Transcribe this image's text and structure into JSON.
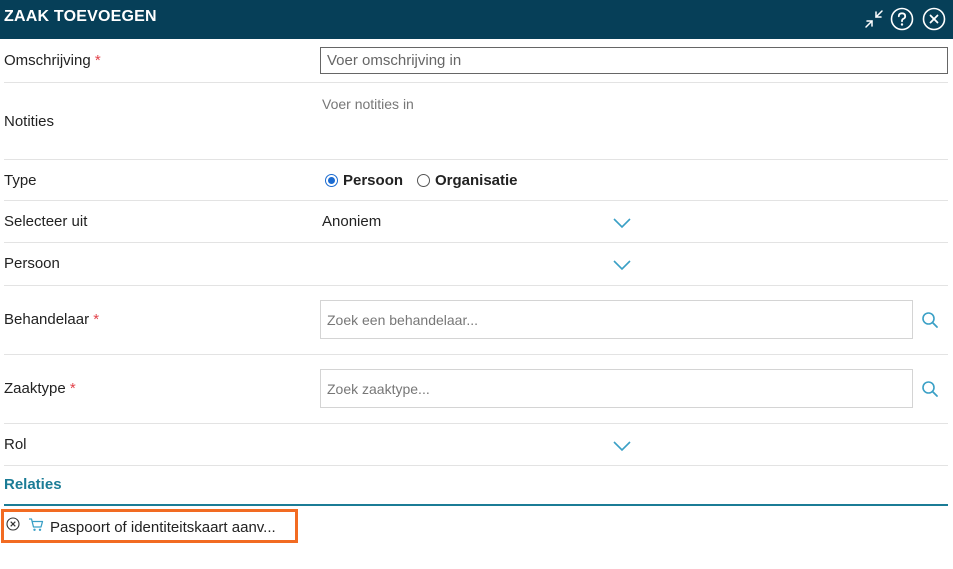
{
  "dialog": {
    "title": "ZAAK TOEVOEGEN",
    "icons": [
      "collapse-icon",
      "help-icon",
      "close-icon"
    ]
  },
  "form": {
    "omschrijving": {
      "label": "Omschrijving",
      "required_mark": "*",
      "placeholder": "Voer omschrijving in"
    },
    "notities": {
      "label": "Notities",
      "placeholder": "Voer notities in"
    },
    "type": {
      "label": "Type",
      "options": [
        {
          "label": "Persoon",
          "selected": true
        },
        {
          "label": "Organisatie",
          "selected": false
        }
      ]
    },
    "selecteer_uit": {
      "label": "Selecteer uit",
      "value": "Anoniem"
    },
    "persoon": {
      "label": "Persoon",
      "value": ""
    },
    "behandelaar": {
      "label": "Behandelaar",
      "required_mark": "*",
      "placeholder": "Zoek een behandelaar..."
    },
    "zaaktype": {
      "label": "Zaaktype",
      "required_mark": "*",
      "placeholder": "Zoek zaaktype..."
    },
    "rol": {
      "label": "Rol",
      "value": ""
    }
  },
  "relaties": {
    "title": "Relaties",
    "items": [
      {
        "text": "Paspoort of identiteitskaart aanv...",
        "icon": "cart-icon",
        "remove_icon": "remove-icon"
      }
    ]
  },
  "colors": {
    "header_bg": "#063f58",
    "accent": "#1b7c96",
    "required": "#e2434b",
    "highlight": "#f26b22",
    "radio_selected": "#1b6bd1"
  }
}
